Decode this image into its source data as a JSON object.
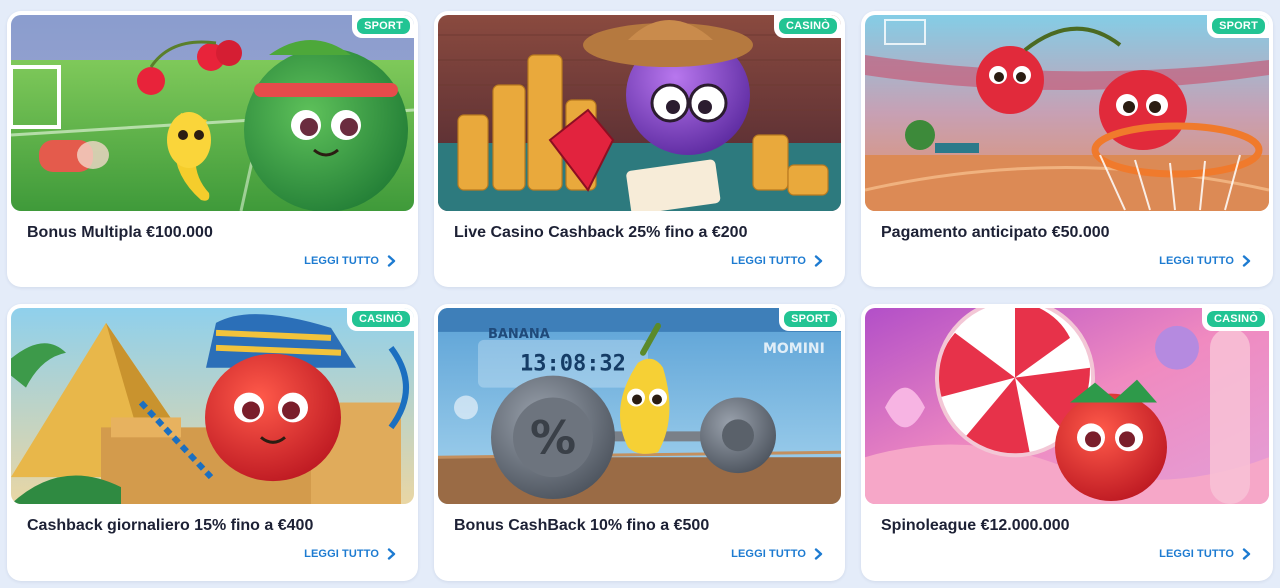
{
  "colors": {
    "page_background": "#e4ecf9",
    "card_background": "#ffffff",
    "badge_green": "#22c493",
    "link_blue": "#1d7bd1",
    "title_text": "#1d2135"
  },
  "cards": [
    {
      "badge": "SPORT",
      "title": "Bonus Multipla €100.000",
      "link": "LEGGI TUTTO",
      "image": "watermelon-banana-cherries-football-field"
    },
    {
      "badge": "CASINÒ",
      "title": "Live Casino Cashback 25% fino a €200",
      "link": "LEGGI TUTTO",
      "image": "purple-cowboy-coins-ruby-cards"
    },
    {
      "badge": "SPORT",
      "title": "Pagamento anticipato €50.000",
      "link": "LEGGI TUTTO",
      "image": "cherries-basketball-hoop-arena"
    },
    {
      "badge": "CASINÒ",
      "title": "Cashback giornaliero 15% fino a €400",
      "link": "LEGGI TUTTO",
      "image": "pharaoh-strawberry-gold-pyramid"
    },
    {
      "badge": "SPORT",
      "title": "Bonus CashBack 10% fino a €500",
      "link": "LEGGI TUTTO",
      "image": "banana-lifting-percent-barbell",
      "image_text": {
        "sign": "BANANA",
        "clock": "13:08:32",
        "logo": "MOMINI"
      }
    },
    {
      "badge": "CASINÒ",
      "title": "Spinoleague €12.000.000",
      "link": "LEGGI TUTTO",
      "image": "strawberry-candy-lollipop-land"
    }
  ]
}
